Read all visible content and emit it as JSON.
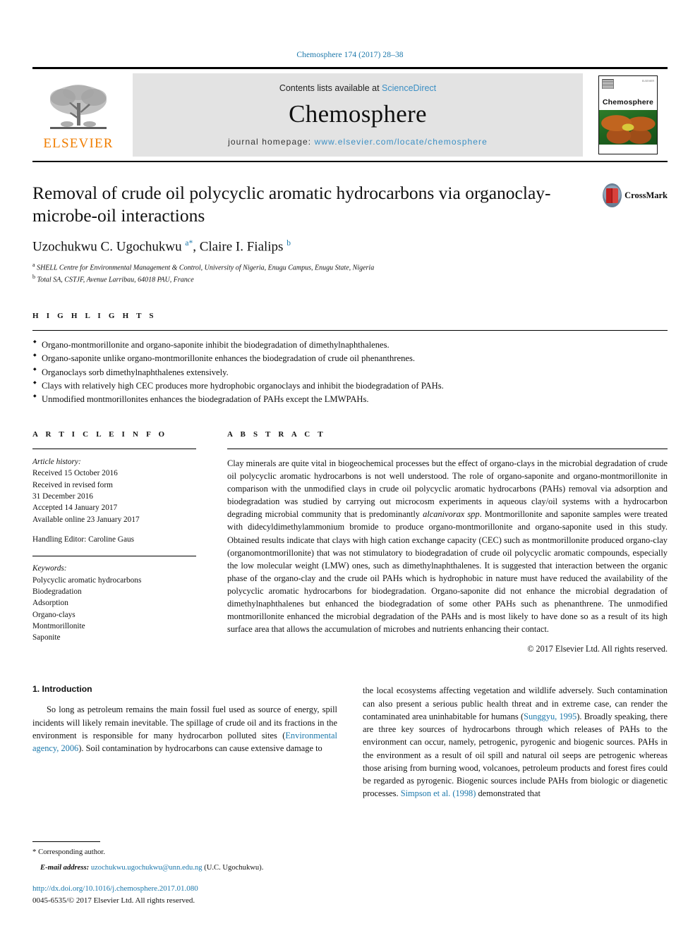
{
  "running_head": "Chemosphere 174 (2017) 28–38",
  "masthead": {
    "publisher_name": "ELSEVIER",
    "contents_prefix": "Contents lists available at ",
    "contents_link": "ScienceDirect",
    "journal_title": "Chemosphere",
    "homepage_label": "journal homepage: ",
    "homepage_url": "www.elsevier.com/locate/chemosphere",
    "cover_title": "Chemosphere",
    "cover_corner": "ELSEVIER"
  },
  "article": {
    "title": "Removal of crude oil polycyclic aromatic hydrocarbons via organoclay-microbe-oil interactions",
    "authors_part1": "Uzochukwu C. Ugochukwu ",
    "authors_sup1": "a",
    "authors_star": "*",
    "authors_part2": ", Claire I. Fialips ",
    "authors_sup2": "b",
    "affiliation_a_sup": "a",
    "affiliation_a": " SHELL Centre for Environmental Management & Control, University of Nigeria, Enugu Campus, Enugu State, Nigeria",
    "affiliation_b_sup": "b",
    "affiliation_b": " Total SA, CSTJF, Avenue Larribau, 64018 PAU, France",
    "crossmark_label": "CrossMark"
  },
  "highlights": {
    "heading": "H I G H L I G H T S",
    "items": [
      "Organo-montmorillonite and organo-saponite inhibit the biodegradation of dimethylnaphthalenes.",
      "Organo-saponite unlike organo-montmorillonite enhances the biodegradation of crude oil phenanthrenes.",
      "Organoclays sorb dimethylnaphthalenes extensively.",
      "Clays with relatively high CEC produces more hydrophobic organoclays and inhibit the biodegradation of PAHs.",
      "Unmodified montmorillonites enhances the biodegradation of PAHs except the LMWPAHs."
    ]
  },
  "article_info": {
    "heading": "A R T I C L E  I N F O",
    "history_label": "Article history:",
    "history_lines": [
      "Received 15 October 2016",
      "Received in revised form",
      "31 December 2016",
      "Accepted 14 January 2017",
      "Available online 23 January 2017"
    ],
    "handling_editor": "Handling Editor: Caroline Gaus",
    "keywords_label": "Keywords:",
    "keywords": [
      "Polycyclic aromatic hydrocarbons",
      "Biodegradation",
      "Adsorption",
      "Organo-clays",
      "Montmorillonite",
      "Saponite"
    ]
  },
  "abstract": {
    "heading": "A B S T R A C T",
    "text_part1": "Clay minerals are quite vital in biogeochemical processes but the effect of organo-clays in the microbial degradation of crude oil polycyclic aromatic hydrocarbons is not well understood. The role of organo-saponite and organo-montmorillonite in comparison with the unmodified clays in crude oil polycyclic aromatic hydrocarbons (PAHs) removal via adsorption and biodegradation was studied by carrying out microcosm experiments in aqueous clay/oil systems with a hydrocarbon degrading microbial community that is predominantly ",
    "italic_species": "alcanivorax spp",
    "text_part2": ". Montmorillonite and saponite samples were treated with didecyldimethylammonium bromide to produce organo-montmorillonite and organo-saponite used in this study. Obtained results indicate that clays with high cation exchange capacity (CEC) such as montmorillonite produced organo-clay (organomontmorillonite) that was not stimulatory to biodegradation of crude oil polycyclic aromatic compounds, especially the low molecular weight (LMW) ones, such as dimethylnaphthalenes. It is suggested that interaction between the organic phase of the organo-clay and the crude oil PAHs which is hydrophobic in nature must have reduced the availability of the polycyclic aromatic hydrocarbons for biodegradation. Organo-saponite did not enhance the microbial degradation of dimethylnaphthalenes but enhanced the biodegradation of some other PAHs such as phenanthrene. The unmodified montmorillonite enhanced the microbial degradation of the PAHs and is most likely to have done so as a result of its high surface area that allows the accumulation of microbes and nutrients enhancing their contact.",
    "copyright": "© 2017 Elsevier Ltd. All rights reserved."
  },
  "introduction": {
    "heading": "1. Introduction",
    "left_part1": "So long as petroleum remains the main fossil fuel used as source of energy, spill incidents will likely remain inevitable. The spillage of crude oil and its fractions in the environment is responsible for many hydrocarbon polluted sites (",
    "left_ref1": "Environmental agency, 2006",
    "left_part2": "). Soil contamination by hydrocarbons can cause extensive damage to",
    "right_part1": "the local ecosystems affecting vegetation and wildlife adversely. Such contamination can also present a serious public health threat and in extreme case, can render the contaminated area uninhabitable for humans (",
    "right_ref1": "Sunggyu, 1995",
    "right_part2": "). Broadly speaking, there are three key sources of hydrocarbons through which releases of PAHs to the environment can occur, namely, petrogenic, pyrogenic and biogenic sources. PAHs in the environment as a result of oil spill and natural oil seeps are petrogenic whereas those arising from burning wood, volcanoes, petroleum products and forest fires could be regarded as pyrogenic. Biogenic sources include PAHs from biologic or diagenetic processes. ",
    "right_ref2": "Simpson et al. (1998)",
    "right_part3": " demonstrated that"
  },
  "footnote": {
    "corresponding_marker": "*",
    "corresponding_text": " Corresponding author.",
    "email_label": "E-mail address:",
    "email": "uzochukwu.ugochukwu@unn.edu.ng",
    "email_suffix": " (U.C. Ugochukwu).",
    "doi": "http://dx.doi.org/10.1016/j.chemosphere.2017.01.080",
    "issn": "0045-6535/© 2017 Elsevier Ltd. All rights reserved."
  },
  "colors": {
    "link": "#1b77aa",
    "elsevier_orange": "#f07d00",
    "masthead_grey": "#e3e3e3"
  }
}
